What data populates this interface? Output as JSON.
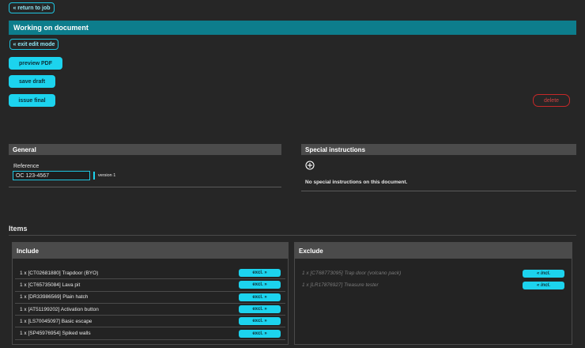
{
  "top": {
    "return_label": "« return to job"
  },
  "header": {
    "title": "Working on document"
  },
  "actions": {
    "exit_edit": "« exit edit mode",
    "preview": "preview PDF",
    "save_draft": "save draft",
    "issue_final": "issue final",
    "delete": "delete"
  },
  "general": {
    "title": "General",
    "reference_label": "Reference",
    "reference_value": "OC 123-4567",
    "version": "version 1"
  },
  "special": {
    "title": "Special instructions",
    "add_icon": "plus-circle-icon",
    "empty_text": "No special instructions on this document."
  },
  "items": {
    "heading": "Items",
    "include": {
      "title": "Include",
      "action_label": "excl. »",
      "rows": [
        "1 x [CT02681880] Trapdoor (BYO)",
        "1 x [CT65735084] Lava pit",
        "1 x [DR33986569] Plain hatch",
        "1 x [AT51199202] Activation button",
        "1 x [LS70045097] Basic escape",
        "1 x [SP45976954] Spiked walls"
      ]
    },
    "exclude": {
      "title": "Exclude",
      "action_label": "« incl.",
      "rows": [
        "1 x [CT68773095] Trap door (volcano pack)",
        "1 x [LR17876927] Treasure tester"
      ]
    }
  },
  "colors": {
    "accent": "#1cd3ee",
    "titlebar": "#0d7d8c",
    "danger": "#c62828",
    "background": "#262626"
  }
}
